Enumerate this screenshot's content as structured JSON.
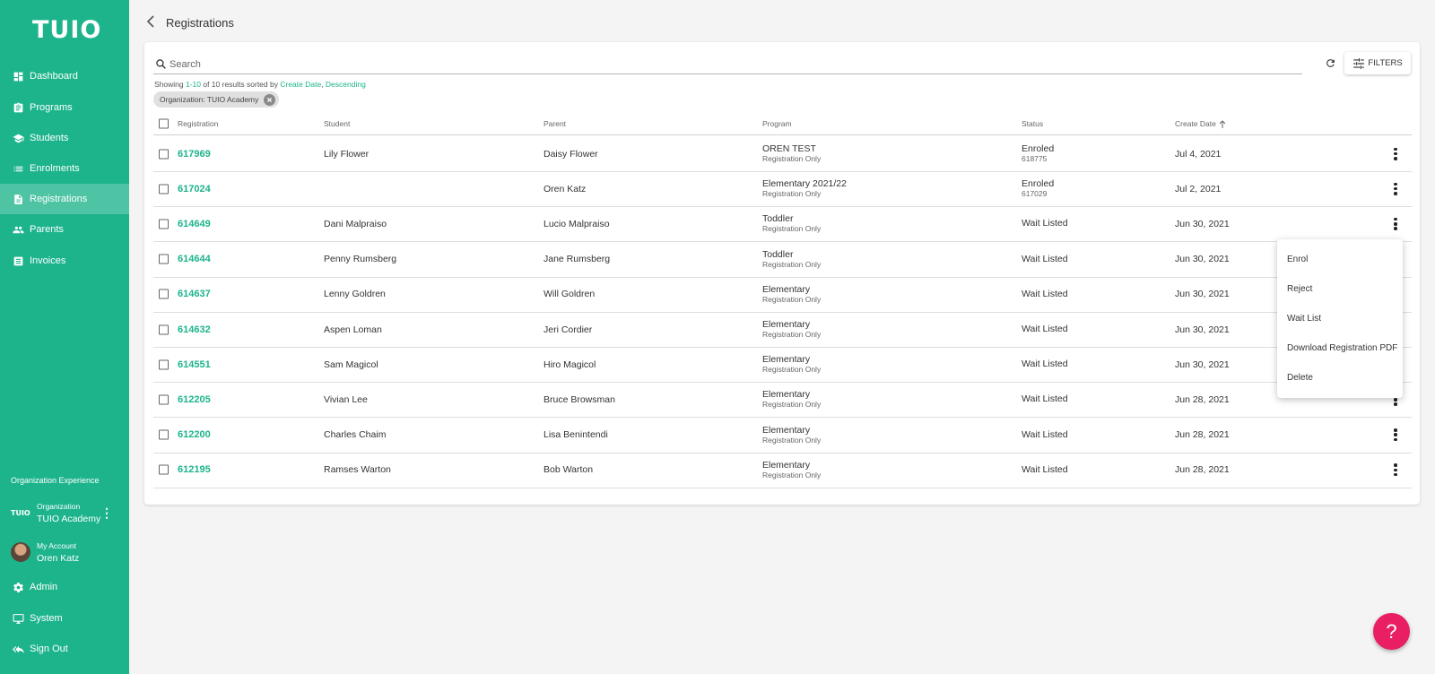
{
  "app": {
    "logo": "TUIO"
  },
  "sidebar": {
    "items": [
      {
        "label": "Dashboard"
      },
      {
        "label": "Programs"
      },
      {
        "label": "Students"
      },
      {
        "label": "Enrolments"
      },
      {
        "label": "Registrations",
        "active": true
      },
      {
        "label": "Parents"
      },
      {
        "label": "Invoices"
      }
    ],
    "section_title": "Organization Experience",
    "organization": {
      "small_logo": "TUIO",
      "label": "Organization",
      "name": "TUIO Academy"
    },
    "account": {
      "label": "My Account",
      "name": "Oren Katz"
    },
    "bottom": [
      {
        "label": "Admin"
      },
      {
        "label": "System"
      },
      {
        "label": "Sign Out"
      }
    ]
  },
  "header": {
    "title": "Registrations"
  },
  "search": {
    "placeholder": "Search",
    "value": ""
  },
  "filters_label": "FILTERS",
  "results": {
    "prefix": "Showing ",
    "range": "1-10",
    "middle": " of 10 results sorted by ",
    "sort_field": "Create Date",
    "sep": ", ",
    "sort_dir": "Descending"
  },
  "chip": {
    "label": "Organization: TUIO Academy"
  },
  "columns": [
    "Registration",
    "Student",
    "Parent",
    "Program",
    "Status",
    "Create Date"
  ],
  "rows": [
    {
      "id": "617969",
      "student": "Lily Flower",
      "parent": "Daisy Flower",
      "program": "OREN TEST",
      "program_sub": "Registration Only",
      "status": "Enroled",
      "status_sub": "618775",
      "date": "Jul 4, 2021"
    },
    {
      "id": "617024",
      "student": "",
      "parent": "Oren Katz",
      "program": "Elementary 2021/22",
      "program_sub": "Registration Only",
      "status": "Enroled",
      "status_sub": "617029",
      "date": "Jul 2, 2021"
    },
    {
      "id": "614649",
      "student": "Dani Malpraiso",
      "parent": "Lucio Malpraiso",
      "program": "Toddler",
      "program_sub": "Registration Only",
      "status": "Wait Listed",
      "status_sub": "",
      "date": "Jun 30, 2021"
    },
    {
      "id": "614644",
      "student": "Penny Rumsberg",
      "parent": "Jane Rumsberg",
      "program": "Toddler",
      "program_sub": "Registration Only",
      "status": "Wait Listed",
      "status_sub": "",
      "date": "Jun 30, 2021"
    },
    {
      "id": "614637",
      "student": "Lenny Goldren",
      "parent": "Will Goldren",
      "program": "Elementary",
      "program_sub": "Registration Only",
      "status": "Wait Listed",
      "status_sub": "",
      "date": "Jun 30, 2021"
    },
    {
      "id": "614632",
      "student": "Aspen Loman",
      "parent": "Jeri Cordier",
      "program": "Elementary",
      "program_sub": "Registration Only",
      "status": "Wait Listed",
      "status_sub": "",
      "date": "Jun 30, 2021"
    },
    {
      "id": "614551",
      "student": "Sam Magicol",
      "parent": "Hiro Magicol",
      "program": "Elementary",
      "program_sub": "Registration Only",
      "status": "Wait Listed",
      "status_sub": "",
      "date": "Jun 30, 2021"
    },
    {
      "id": "612205",
      "student": "Vivian Lee",
      "parent": "Bruce Browsman",
      "program": "Elementary",
      "program_sub": "Registration Only",
      "status": "Wait Listed",
      "status_sub": "",
      "date": "Jun 28, 2021"
    },
    {
      "id": "612200",
      "student": "Charles Chaim",
      "parent": "Lisa Benintendi",
      "program": "Elementary",
      "program_sub": "Registration Only",
      "status": "Wait Listed",
      "status_sub": "",
      "date": "Jun 28, 2021"
    },
    {
      "id": "612195",
      "student": "Ramses Warton",
      "parent": "Bob Warton",
      "program": "Elementary",
      "program_sub": "Registration Only",
      "status": "Wait Listed",
      "status_sub": "",
      "date": "Jun 28, 2021"
    }
  ],
  "context_menu": {
    "items": [
      "Enrol",
      "Reject",
      "Wait List",
      "Download Registration PDF",
      "Delete"
    ]
  },
  "help": {
    "label": "?"
  },
  "colors": {
    "brand": "#1db48c",
    "help": "#e91e63"
  }
}
